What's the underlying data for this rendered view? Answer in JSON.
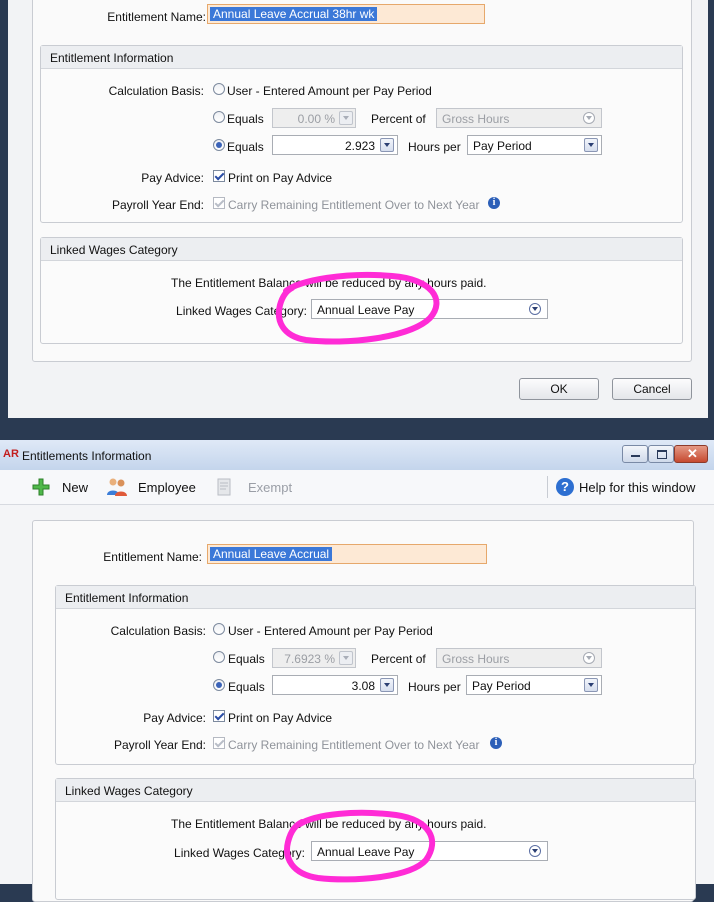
{
  "window": {
    "app_badge": "AR",
    "title": "Entitlements Information"
  },
  "toolbar": {
    "new_label": "New",
    "employee_label": "Employee",
    "exempt_label": "Exempt",
    "help_label": "Help for this window",
    "help_glyph": "?"
  },
  "labels": {
    "entitlement_name": "Entitlement Name:",
    "entitlement_information": "Entitlement Information",
    "calculation_basis": "Calculation Basis:",
    "user_entered": "User - Entered Amount per Pay Period",
    "equals": "Equals",
    "percent_of": "Percent of",
    "hours_per": "Hours per",
    "pay_advice": "Pay Advice:",
    "print_on_pay_advice": "Print on Pay Advice",
    "payroll_year_end": "Payroll Year End:",
    "carry_remaining": "Carry Remaining Entitlement Over to Next Year",
    "linked_wages_category_section": "Linked Wages Category",
    "balance_note": "The Entitlement Balance will be reduced by any hours paid.",
    "linked_wages_category": "Linked Wages Category:",
    "info_glyph": "i"
  },
  "top_dialog": {
    "entitlement_name_value": "Annual Leave Accrual 38hr wk",
    "percent_value": "0.00 %",
    "percent_of_value": "Gross Hours",
    "hours_value": "2.923",
    "hours_per_value": "Pay Period",
    "linked_wages_value": "Annual Leave Pay",
    "ok_label": "OK",
    "cancel_label": "Cancel"
  },
  "bottom_dialog": {
    "entitlement_name_value": "Annual Leave Accrual",
    "percent_value": "7.6923 %",
    "percent_of_value": "Gross Hours",
    "hours_value": "3.08",
    "hours_per_value": "Pay Period",
    "linked_wages_value": "Annual Leave Pay"
  },
  "colors": {
    "highlight": "#ff2bd6",
    "selection": "#3b78d8",
    "name_field_bg": "#fde9d5"
  }
}
